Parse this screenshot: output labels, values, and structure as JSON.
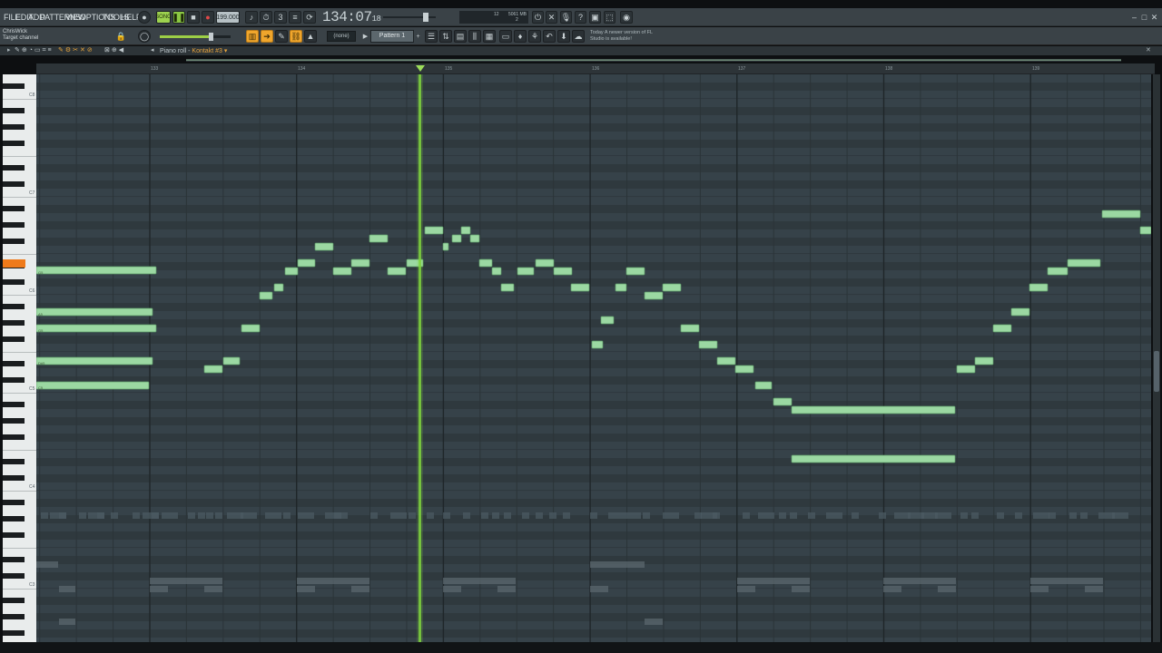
{
  "menu": [
    "FILE",
    "EDIT",
    "ADD",
    "PATTERNS",
    "VIEW",
    "OPTIONS",
    "TOOLS",
    "HELP"
  ],
  "transport": {
    "mode": "SONG",
    "tempo": "199.000",
    "time_main": "134:07",
    "time_sub": "18",
    "cpu": "12",
    "memory": "5061 MB",
    "poly": "2"
  },
  "hint": {
    "line1": "ChrisWick",
    "line2": "Target channel"
  },
  "pattern": {
    "name": "Pattern 1",
    "channel_select": "(none)"
  },
  "news": {
    "line1": "Today  A newer version of FL",
    "line2": "Studio is available!"
  },
  "piano_roll": {
    "title": "Piano roll - ",
    "channel": "Kontakt #3"
  },
  "ruler_bars": [
    "133",
    "134",
    "135",
    "136",
    "137",
    "138",
    "139"
  ],
  "octave_labels": [
    "C8",
    "C7",
    "C6",
    "C5",
    "C4",
    "C3"
  ],
  "colors": {
    "note": "#9bd8a2",
    "note_border": "#5e9c6a",
    "grid_bg": "#323c41",
    "playhead": "#7ed23e",
    "highlight_key": "#ef7a1a"
  },
  "notes": [
    {
      "label": "G5",
      "pitch": "G5"
    },
    {
      "label": "A5",
      "pitch": "A5"
    },
    {
      "label": "G5",
      "pitch": "G5"
    },
    {
      "label": "D#5",
      "pitch": "D#5"
    },
    {
      "label": "C5",
      "pitch": "C5"
    }
  ]
}
